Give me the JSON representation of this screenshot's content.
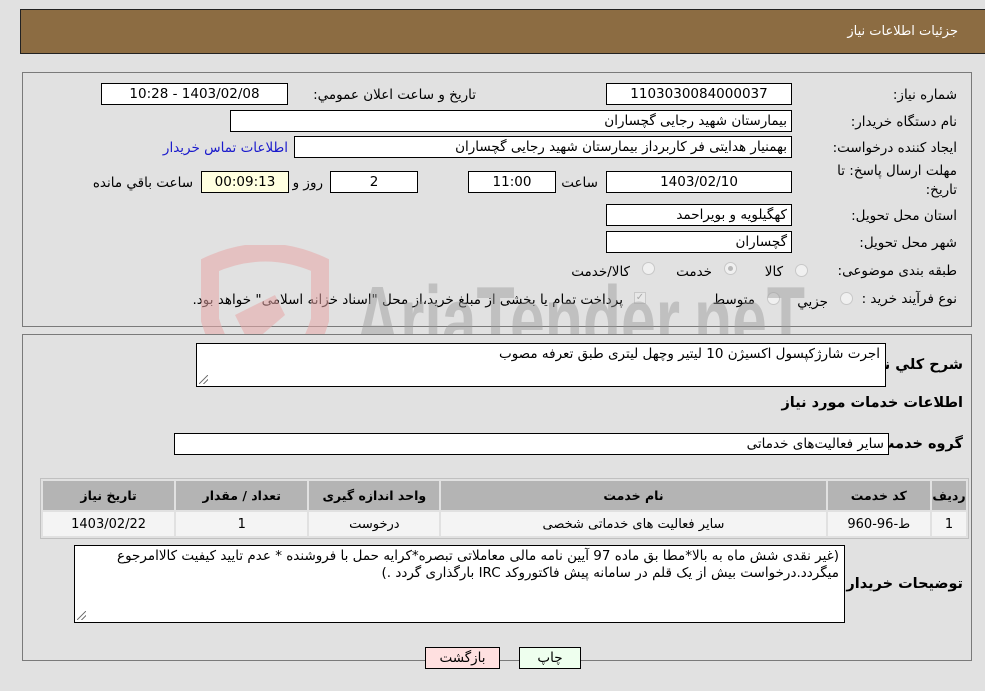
{
  "header": {
    "title": "جزئیات اطلاعات نیاز"
  },
  "details": {
    "need_number": {
      "label": "شماره نیاز:",
      "value": "1103030084000037"
    },
    "announce_datetime": {
      "label": "تاریخ و ساعت اعلان عمومي:",
      "value": "1403/02/08 - 10:28"
    },
    "buyer_org": {
      "label": "نام دستگاه خریدار:",
      "value": "بیمارستان شهید رجایی گچساران"
    },
    "requester": {
      "label": "ایجاد کننده درخواست:",
      "value": "بهمنیار هدایتی فر کاربرداز بیمارستان شهید رجایی گچساران",
      "contact_link": "اطلاعات تماس خریدار"
    },
    "deadline": {
      "label_line1": "مهلت ارسال پاسخ: تا",
      "label_line2": "تاریخ:",
      "date": "1403/02/10",
      "time_label": "ساعت",
      "time": "11:00",
      "days": "2",
      "days_label": "روز و",
      "remaining": "00:09:13",
      "remaining_label": "ساعت باقي مانده"
    },
    "province": {
      "label": "استان محل تحویل:",
      "value": "کهگیلویه و بویراحمد"
    },
    "city": {
      "label": "شهر محل تحویل:",
      "value": "گچساران"
    },
    "category": {
      "label": "طبقه بندی موضوعی:",
      "options": [
        {
          "label": "کالا",
          "checked": false
        },
        {
          "label": "خدمت",
          "checked": true
        },
        {
          "label": "کالا/خدمت",
          "checked": false
        }
      ]
    },
    "purchase_type": {
      "label": "نوع فرآیند خرید :",
      "options": [
        {
          "label": "جزيي",
          "checked": false
        },
        {
          "label": "متوسط",
          "checked": false
        }
      ],
      "treasury_note": "پرداخت تمام یا بخشی از مبلغ خرید،از محل \"اسناد خزانه اسلامی\" خواهد بود.",
      "treasury_checked": true
    }
  },
  "need": {
    "summary_label": "شرح كلي نياز:",
    "summary_value": "اجرت شارژکپسول اکسیژن 10 لیتیر وچهل لیتری  طبق تعرفه مصوب",
    "services_title": "اطلاعات خدمات مورد نیاز",
    "service_group_label": "گروه خدمت:",
    "service_group_value": "سایر فعالیت‌های خدماتی"
  },
  "table": {
    "columns": [
      "ردیف",
      "کد خدمت",
      "نام خدمت",
      "واحد اندازه گیری",
      "تعداد / مقدار",
      "تاریخ نیاز"
    ],
    "rows": [
      [
        "1",
        "ط-96-960",
        "سایر فعالیت های خدماتی شخصی",
        "درخوست",
        "1",
        "1403/02/22"
      ]
    ]
  },
  "buyer_notes": {
    "label": "توضیحات خریدار:",
    "value": "(غیر نقدی شش  ماه به بالا*مطا بق ماده 97 آیین نامه مالی معاملاتی تبصره*کرایه حمل با فروشنده * عدم تایید کیفیت کالاامرجوع میگردد.درخواست بیش از یک قلم در سامانه  پیش فاکتوروکد IRC بارگذاری گردد .)"
  },
  "buttons": {
    "print": "چاپ",
    "back": "بازگشت"
  },
  "watermark": {
    "text": "AriaTender.neT"
  }
}
